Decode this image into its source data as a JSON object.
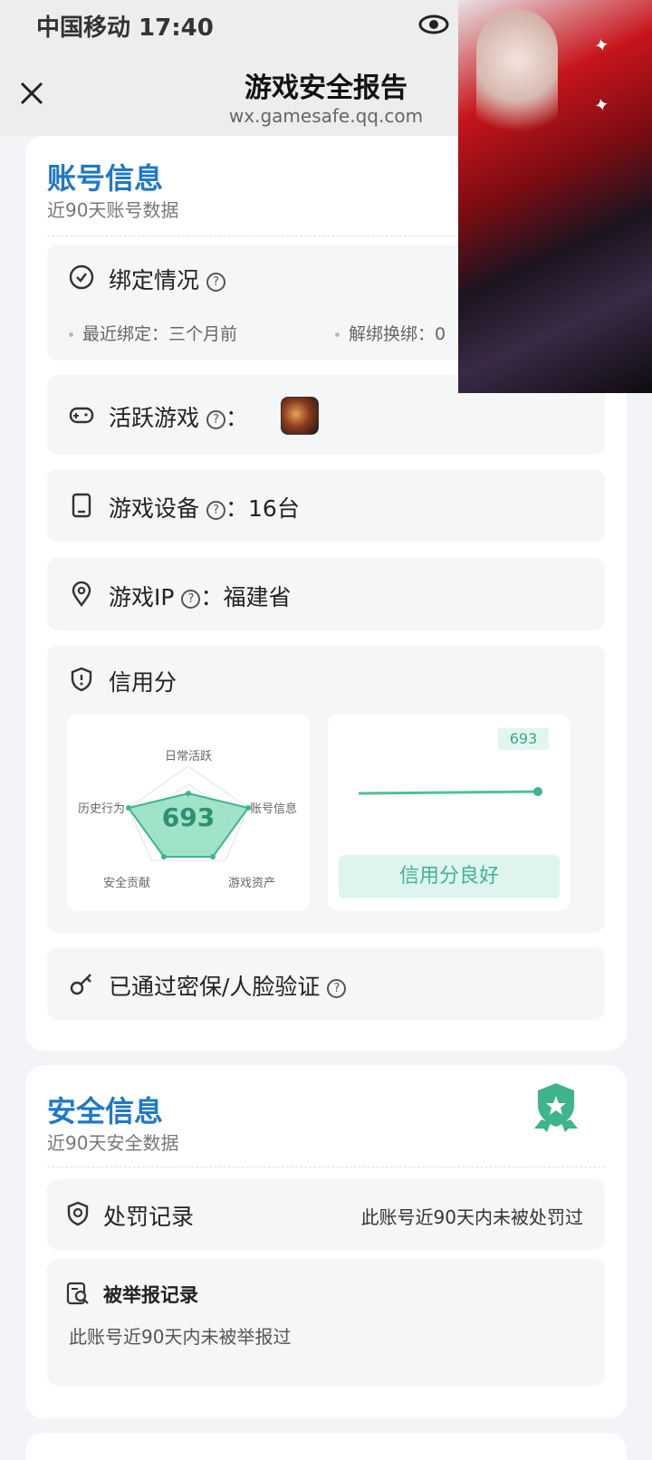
{
  "status_bar": {
    "carrier_time": "中国移动 17:40"
  },
  "nav": {
    "title": "游戏安全报告",
    "domain": "wx.gamesafe.qq.com"
  },
  "account_section": {
    "title": "账号信息",
    "subtitle": "近90天账号数据",
    "binding": {
      "label": "绑定情况",
      "recent_bind": "最近绑定：三个月前",
      "unbind": "解绑换绑：0"
    },
    "active_games": {
      "label": "活跃游戏",
      "colon": "："
    },
    "devices": {
      "label": "游戏设备",
      "value": "：16台"
    },
    "ip": {
      "label": "游戏IP",
      "value": "：福建省"
    },
    "credit": {
      "label": "信用分",
      "score": "693",
      "status": "信用分良好",
      "radar_labels": [
        "日常活跃",
        "账号信息",
        "游戏资产",
        "安全贡献",
        "历史行为"
      ]
    },
    "verified": {
      "label": "已通过密保/人脸验证"
    }
  },
  "security_section": {
    "title": "安全信息",
    "subtitle": "近90天安全数据",
    "penalty": {
      "label": "处罚记录",
      "value": "此账号近90天内未被处罚过"
    },
    "report": {
      "label": "被举报记录",
      "value": "此账号近90天内未被举报过"
    }
  },
  "help_glyph": "?",
  "icons": [
    "eye-icon",
    "close-icon",
    "clock-check-icon",
    "gamepad-icon",
    "tablet-icon",
    "location-pin-icon",
    "shield-icon",
    "key-icon",
    "security-badge-icon",
    "shield-alert-icon",
    "search-document-icon"
  ],
  "colors": {
    "title_blue": "#1f78c8",
    "green": "#3fb494",
    "card_bg": "#ffffff",
    "row_bg": "#f5f6f8"
  }
}
